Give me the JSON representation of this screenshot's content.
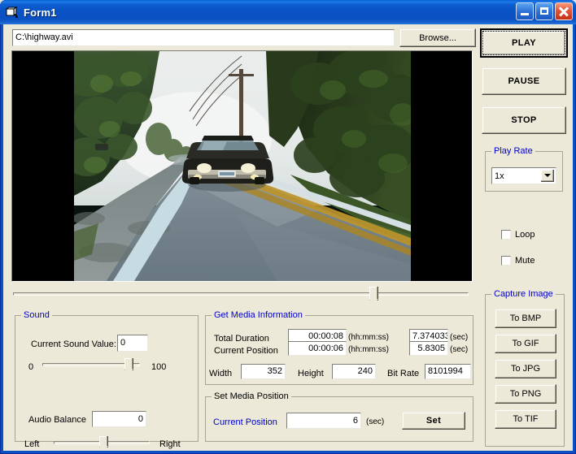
{
  "window": {
    "title": "Form1",
    "icon": "vb-form-icon",
    "buttons": {
      "minimize": "minimize-button",
      "maximize": "maximize-button",
      "close": "close-button"
    }
  },
  "file": {
    "path_value": "C:\\highway.avi",
    "browse_label": "Browse..."
  },
  "transport": {
    "play_label": "PLAY",
    "pause_label": "PAUSE",
    "stop_label": "STOP"
  },
  "play_rate": {
    "caption": "Play Rate",
    "selected": "1x",
    "options": [
      "1x"
    ]
  },
  "options": {
    "loop_label": "Loop",
    "loop_checked": false,
    "mute_label": "Mute",
    "mute_checked": false
  },
  "capture": {
    "caption": "Capture Image",
    "buttons": [
      "To BMP",
      "To GIF",
      "To JPG",
      "To PNG",
      "To TIF"
    ]
  },
  "seek": {
    "position_percent": 79
  },
  "sound": {
    "caption": "Sound",
    "current_label": "Current Sound Value:",
    "current_value": "0",
    "volume_min": "0",
    "volume_max": "100",
    "volume_percent": 88,
    "balance_label": "Audio Balance",
    "balance_value": "0",
    "balance_left": "Left",
    "balance_right": "Right",
    "balance_percent": 50
  },
  "media_info": {
    "caption": "Get Media Information",
    "rows": [
      {
        "label": "Total Duration",
        "hms_value": "00:00:08",
        "hms_unit": "(hh:mm:ss)",
        "sec_value": "7.374033",
        "sec_unit": "(sec)"
      },
      {
        "label": "Current Position",
        "hms_value": "00:00:06",
        "hms_unit": "(hh:mm:ss)",
        "sec_value": "5.8305",
        "sec_unit": "(sec)"
      }
    ],
    "width_label": "Width",
    "width_value": "352",
    "height_label": "Height",
    "height_value": "240",
    "bitrate_label": "Bit Rate",
    "bitrate_value": "8101994"
  },
  "set_position": {
    "caption": "Set Media Position",
    "label": "Current Position",
    "value": "6",
    "unit": "(sec)",
    "set_label": "Set"
  },
  "colors": {
    "face": "#ece9d8",
    "caption_blue": "#0000cc",
    "title_blue": "#0a52c8"
  }
}
